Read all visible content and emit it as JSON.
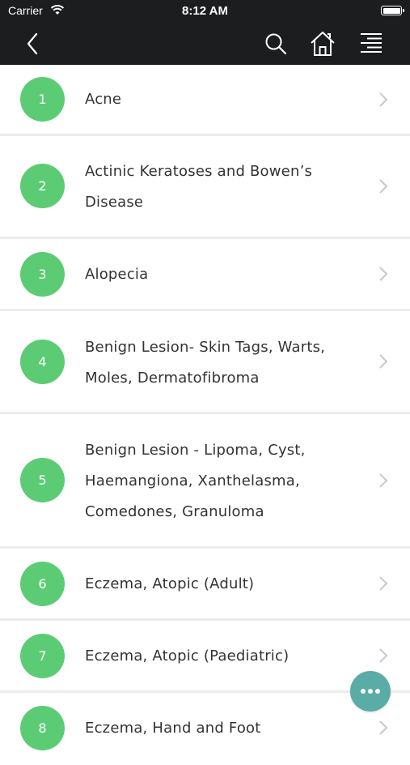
{
  "status_bar": {
    "carrier": "Carrier",
    "time": "8:12 AM"
  },
  "nav": {
    "back_icon": "chevron-left-icon",
    "search_icon": "search-icon",
    "home_icon": "home-icon",
    "menu_icon": "align-right-menu-icon"
  },
  "items": [
    {
      "number": "1",
      "title": "Acne"
    },
    {
      "number": "2",
      "title": "Actinic Keratoses and Bowen’s Disease"
    },
    {
      "number": "3",
      "title": "Alopecia"
    },
    {
      "number": "4",
      "title": "Benign Lesion- Skin Tags, Warts, Moles, Dermatofibroma"
    },
    {
      "number": "5",
      "title": "Benign Lesion - Lipoma, Cyst, Haemangiona, Xanthelasma, Comedones, Granuloma"
    },
    {
      "number": "6",
      "title": "Eczema, Atopic (Adult)"
    },
    {
      "number": "7",
      "title": "Eczema, Atopic (Paediatric)"
    },
    {
      "number": "8",
      "title": "Eczema, Hand and Foot"
    }
  ],
  "fab": {
    "icon": "more-dots-icon"
  },
  "colors": {
    "nav_bg": "#1b1d1f",
    "badge": "#5ccc74",
    "fab": "#5aaca6",
    "divider": "#ececec",
    "text": "#333333"
  }
}
